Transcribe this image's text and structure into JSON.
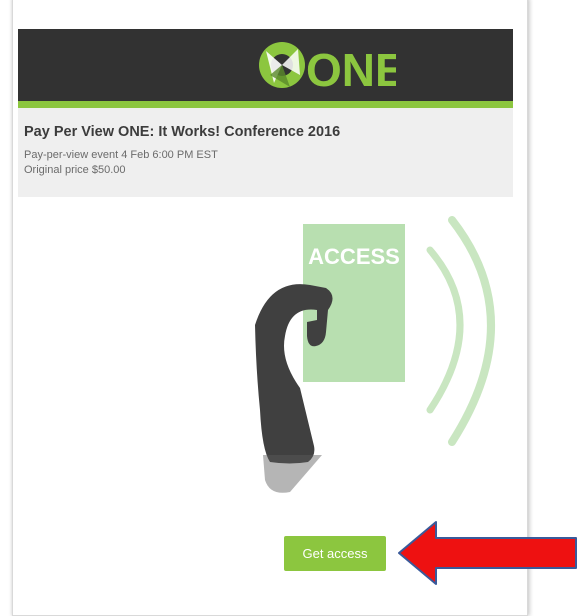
{
  "event": {
    "title": "Pay Per View ONE: It Works! Conference 2016",
    "schedule": "Pay-per-view event 4 Feb 6:00 PM EST",
    "price": "Original price $50.00"
  },
  "logo": {
    "text": "ONE"
  },
  "card_label": "ACCESS",
  "action": {
    "label": "Get access"
  },
  "colors": {
    "brand_green": "#8cc63f",
    "banner_dark": "#323232",
    "card_green": "#b8dfb0",
    "arrow_red": "#ee1111",
    "arrow_outline": "#3a5a9a"
  },
  "icons": [
    "one-logo-icon",
    "hand-holding-card-icon",
    "signal-waves-icon",
    "red-arrow-icon"
  ]
}
